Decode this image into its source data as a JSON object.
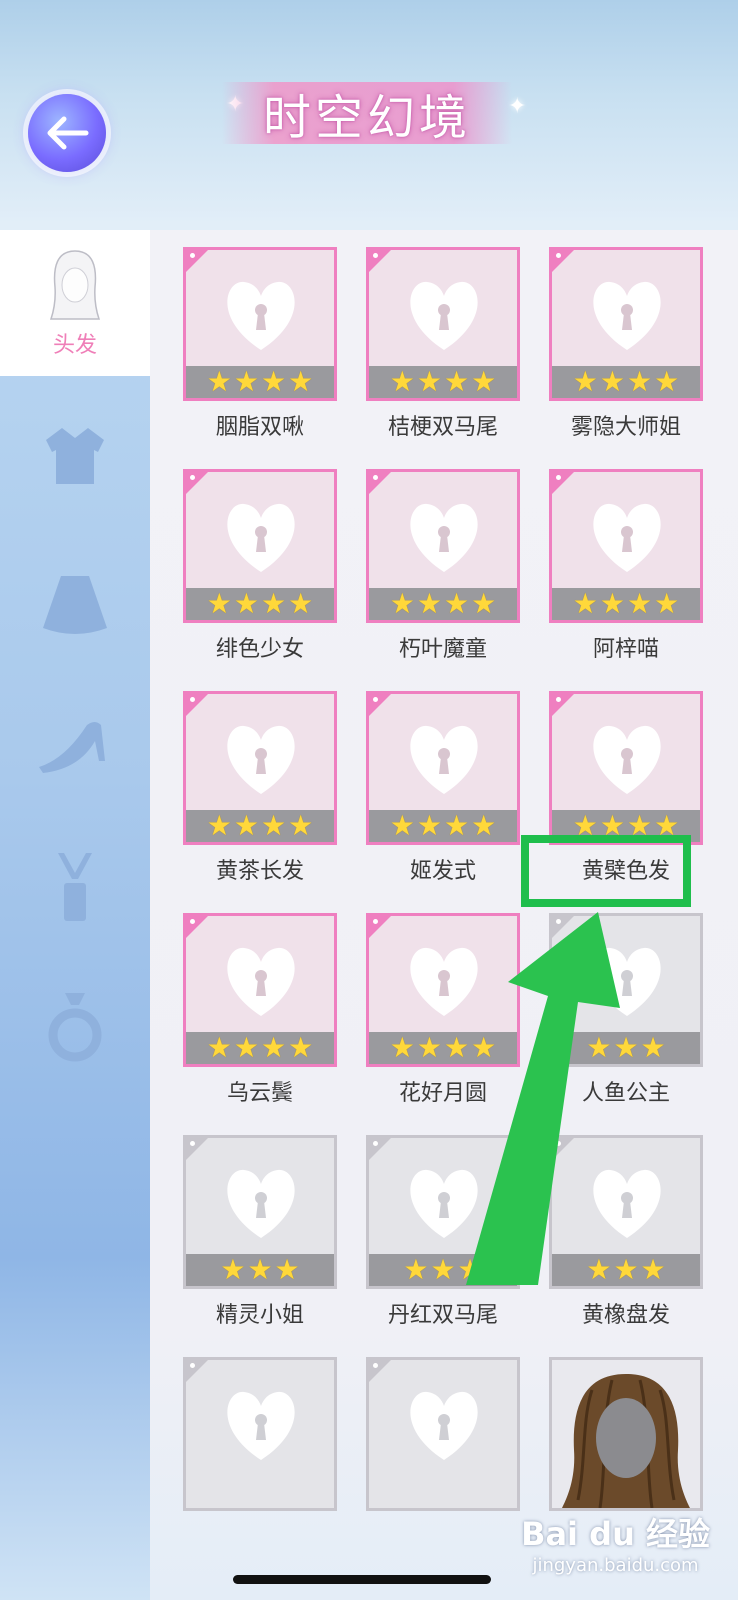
{
  "header": {
    "title": "时空幻境",
    "back_icon": "back-arrow-icon"
  },
  "sidebar": {
    "active": {
      "label": "头发",
      "icon": "hair-icon"
    },
    "items": [
      {
        "icon": "top-clothing-icon"
      },
      {
        "icon": "skirt-icon"
      },
      {
        "icon": "shoes-icon"
      },
      {
        "icon": "makeup-icon"
      },
      {
        "icon": "ring-icon"
      }
    ]
  },
  "grid": {
    "items": [
      {
        "name": "胭脂双啾",
        "stars": 4,
        "style": "pink",
        "locked": true
      },
      {
        "name": "桔梗双马尾",
        "stars": 4,
        "style": "pink",
        "locked": true
      },
      {
        "name": "雾隐大师姐",
        "stars": 4,
        "style": "pink",
        "locked": true
      },
      {
        "name": "绯色少女",
        "stars": 4,
        "style": "pink",
        "locked": true
      },
      {
        "name": "朽叶魔童",
        "stars": 4,
        "style": "pink",
        "locked": true
      },
      {
        "name": "阿梓喵",
        "stars": 4,
        "style": "pink",
        "locked": true
      },
      {
        "name": "黄茶长发",
        "stars": 4,
        "style": "pink",
        "locked": true
      },
      {
        "name": "姬发式",
        "stars": 4,
        "style": "pink",
        "locked": true
      },
      {
        "name": "黄檗色发",
        "stars": 4,
        "style": "pink",
        "locked": true
      },
      {
        "name": "乌云鬓",
        "stars": 4,
        "style": "pink",
        "locked": true
      },
      {
        "name": "花好月圆",
        "stars": 4,
        "style": "pink",
        "locked": true
      },
      {
        "name": "人鱼公主",
        "stars": 3,
        "style": "grey",
        "locked": true
      },
      {
        "name": "精灵小姐",
        "stars": 3,
        "style": "grey",
        "locked": true
      },
      {
        "name": "丹红双马尾",
        "stars": 3,
        "style": "grey",
        "locked": true
      },
      {
        "name": "黄橡盘发",
        "stars": 3,
        "style": "grey",
        "locked": true
      },
      {
        "name": "",
        "stars": 0,
        "style": "grey",
        "locked": true
      },
      {
        "name": "",
        "stars": 0,
        "style": "grey",
        "locked": true
      },
      {
        "name": "",
        "stars": 0,
        "style": "grey",
        "locked": false
      }
    ]
  },
  "annotation": {
    "color": "#1fbe4c"
  },
  "watermark": {
    "logo": "Bai du 经验",
    "url": "jingyan.baidu.com"
  }
}
